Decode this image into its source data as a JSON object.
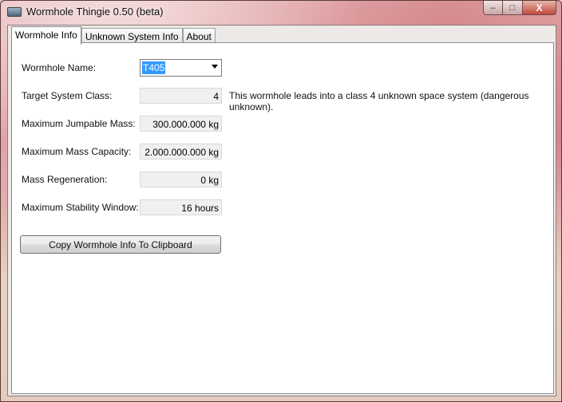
{
  "window": {
    "title": "Wormhole Thingie 0.50 (beta)",
    "controls": {
      "minimize": "–",
      "maximize": "□",
      "close": "X"
    }
  },
  "tabs": [
    {
      "label": "Wormhole Info",
      "active": true
    },
    {
      "label": "Unknown System Info",
      "active": false
    },
    {
      "label": "About",
      "active": false
    }
  ],
  "wormhole_info": {
    "name": {
      "label": "Wormhole Name:",
      "value": "T405"
    },
    "target_class": {
      "label": "Target System Class:",
      "value": "4"
    },
    "target_description": "This wormhole leads into a class 4 unknown space system (dangerous unknown).",
    "max_jump_mass": {
      "label": "Maximum Jumpable Mass:",
      "value": "300.000.000 kg"
    },
    "max_mass_capacity": {
      "label": "Maximum Mass Capacity:",
      "value": "2.000.000.000 kg"
    },
    "mass_regen": {
      "label": "Mass Regeneration:",
      "value": "0 kg"
    },
    "max_stability": {
      "label": "Maximum Stability Window:",
      "value": "16 hours"
    },
    "copy_button": "Copy Wormhole Info To Clipboard"
  },
  "colors": {
    "selection": "#3399ff",
    "close_button": "#c2473a"
  }
}
